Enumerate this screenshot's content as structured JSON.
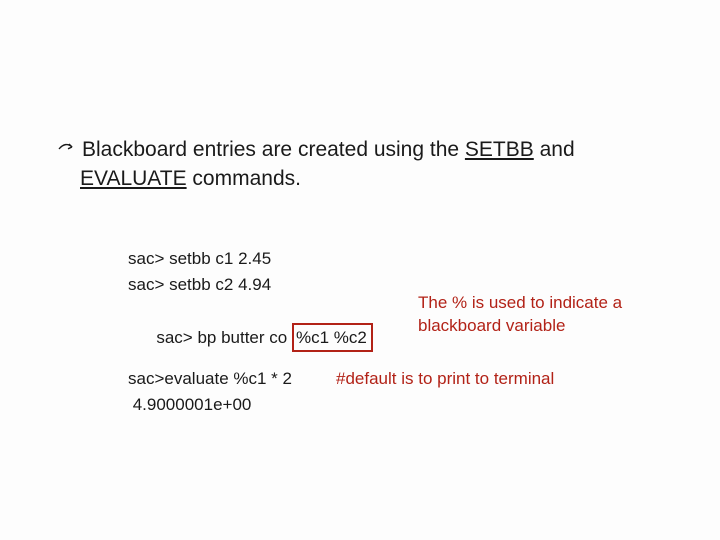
{
  "intro": {
    "prefix": "Blackboard entries are created using the ",
    "cmd1": "SETBB",
    "mid": " and ",
    "cmd2": "EVALUATE",
    "suffix": " commands."
  },
  "code": {
    "line1": "sac> setbb c1 2.45",
    "line2": "sac> setbb c2 4.94",
    "line3_pre": "sac> bp butter co ",
    "line3_box": "%c1 %c2"
  },
  "note_right": "The % is used to indicate a blackboard variable",
  "eval": {
    "line1": "sac>evaluate %c1 * 2",
    "line2": " 4.9000001e+00",
    "comment": "#default is to print to terminal"
  }
}
